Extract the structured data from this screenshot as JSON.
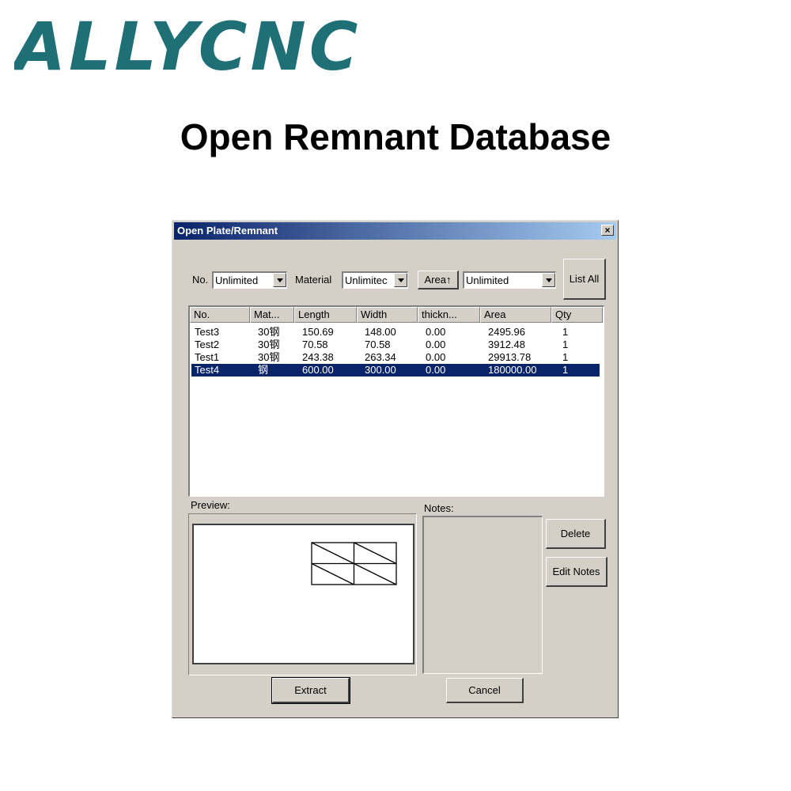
{
  "brand": {
    "logo_text": "ALLYCNC",
    "color": "#1f6f77"
  },
  "heading": "Open Remnant Database",
  "dialog": {
    "title": "Open Plate/Remnant",
    "close_glyph": "×",
    "filters": {
      "no_label": "No.",
      "no_value": "Unlimited",
      "material_label": "Material",
      "material_value": "Unlimitec",
      "area_button": "Area↑",
      "area_value": "Unlimited",
      "list_all": "List All"
    },
    "columns": [
      "No.",
      "Mat...",
      "Length",
      "Width",
      "thickn...",
      "Area",
      "Qty"
    ],
    "rows": [
      {
        "no": "Test3",
        "mat": "30钢",
        "length": "150.69",
        "width": "148.00",
        "thickness": "0.00",
        "area": "2495.96",
        "qty": "1",
        "selected": false
      },
      {
        "no": "Test2",
        "mat": "30钢",
        "length": "70.58",
        "width": "70.58",
        "thickness": "0.00",
        "area": "3912.48",
        "qty": "1",
        "selected": false
      },
      {
        "no": "Test1",
        "mat": "30钢",
        "length": "243.38",
        "width": "263.34",
        "thickness": "0.00",
        "area": "29913.78",
        "qty": "1",
        "selected": false
      },
      {
        "no": "Test4",
        "mat": "钢",
        "length": "600.00",
        "width": "300.00",
        "thickness": "0.00",
        "area": "180000.00",
        "qty": "1",
        "selected": true
      }
    ],
    "preview_label": "Preview:",
    "notes_label": "Notes:",
    "buttons": {
      "delete": "Delete",
      "edit_notes": "Edit Notes",
      "extract": "Extract",
      "cancel": "Cancel"
    },
    "colors": {
      "selection": "#0a246a",
      "face": "#d4d0c8"
    }
  }
}
